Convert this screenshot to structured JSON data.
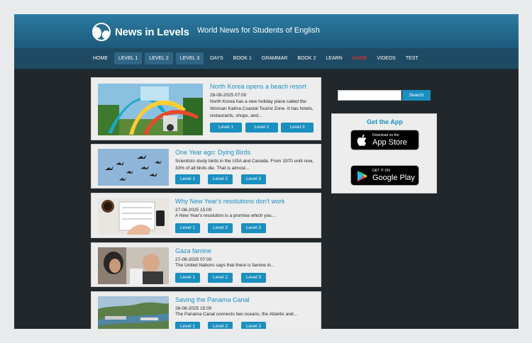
{
  "header": {
    "logo": "News in Levels",
    "tagline": "World News for Students of English"
  },
  "nav": {
    "items": [
      {
        "label": "HOME",
        "boxed": false
      },
      {
        "label": "LEVEL 1",
        "boxed": true
      },
      {
        "label": "LEVEL 2",
        "boxed": true
      },
      {
        "label": "LEVEL 3",
        "boxed": true
      },
      {
        "label": "DAYS",
        "boxed": false
      },
      {
        "label": "BOOK 1",
        "boxed": false
      },
      {
        "label": "GRAMMAR",
        "boxed": false
      },
      {
        "label": "BOOK 2",
        "boxed": false
      },
      {
        "label": "LEARN",
        "boxed": false
      },
      {
        "label": "GAME",
        "boxed": false,
        "color": "#ff2a2a"
      },
      {
        "label": "VIDEOS",
        "boxed": false
      },
      {
        "label": "TEST",
        "boxed": false
      }
    ]
  },
  "articles": [
    {
      "title": "North Korea opens a beach resort",
      "date": "28-08-2025 07:00",
      "excerpt": "North Korea has a new holiday place called the Wonsan Kalma Coastal Tourist Zone. It has hotels, restaurants, shops, and...",
      "levels": [
        "Level 1",
        "Level 2",
        "Level 3"
      ]
    },
    {
      "title": "One Year ago: Dying Birds",
      "date": "",
      "excerpt": "Scientists study birds in the USA and Canada. From 1970 until now, 33% of all birds die. That is almost...",
      "levels": [
        "Level 1",
        "Level 2",
        "Level 3"
      ]
    },
    {
      "title": "Why New Year's resolutions don't work",
      "date": "27-08-2025 15:00",
      "excerpt": "A New Year's resolution is a promise which you...",
      "levels": [
        "Level 1",
        "Level 2",
        "Level 3"
      ]
    },
    {
      "title": "Gaza famine",
      "date": "27-08-2025 07:00",
      "excerpt": "The United Nations says that there is famine in...",
      "levels": [
        "Level 1",
        "Level 2",
        "Level 3"
      ]
    },
    {
      "title": "Saving the Panama Canal",
      "date": "26-08-2025 15:00",
      "excerpt": "The Panama Canal connects two oceans, the Atlantic and...",
      "levels": [
        "Level 1",
        "Level 2",
        "Level 3"
      ]
    }
  ],
  "sidebar": {
    "search_placeholder": "",
    "search_button": "Search",
    "app_title": "Get the App",
    "app_store": {
      "small": "Download on the",
      "big": "App Store"
    },
    "google_play": {
      "small": "GET IT ON",
      "big": "Google Play"
    }
  }
}
